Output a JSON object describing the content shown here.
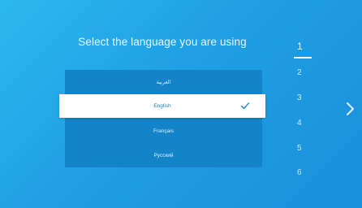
{
  "header": {
    "title": "Select the language you are using"
  },
  "languages": [
    {
      "label": "العربية"
    },
    {
      "label": "English"
    },
    {
      "label": "Français"
    },
    {
      "label": "Русский"
    }
  ],
  "selected_index": 1,
  "steps": [
    "1",
    "2",
    "3",
    "4",
    "5",
    "6"
  ],
  "active_step": "1",
  "icons": {
    "check": "check-icon",
    "next": "chevron-right-icon"
  },
  "colors": {
    "background": "#1f9fe4",
    "list": "#1583c8",
    "selected": "#ffffff",
    "accent": "#1a7fc4"
  }
}
